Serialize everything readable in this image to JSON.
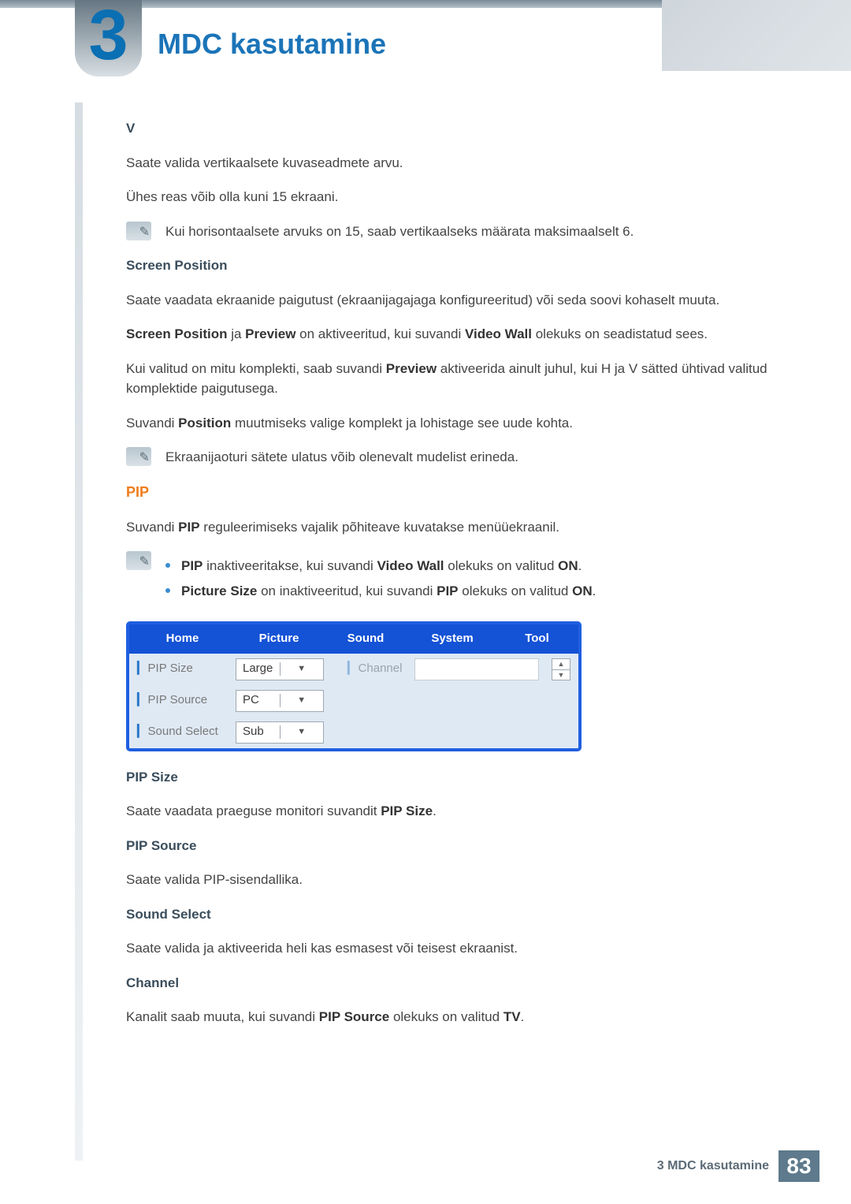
{
  "chapter": {
    "num": "3",
    "title": "MDC kasutamine"
  },
  "v": {
    "heading": "V",
    "p1": "Saate valida vertikaalsete kuvaseadmete arvu.",
    "p2": "Ühes reas võib olla kuni 15 ekraani.",
    "note": "Kui horisontaalsete arvuks on 15, saab vertikaalseks määrata maksimaalselt 6."
  },
  "sp": {
    "heading": "Screen Position",
    "p1": "Saate vaadata ekraanide paigutust (ekraanijagajaga konfigureeritud) või seda soovi kohaselt muuta.",
    "p2": "Screen Position ja Preview on aktiveeritud, kui suvandi Video Wall olekuks on seadistatud sees.",
    "p3": "Kui valitud on mitu komplekti, saab suvandi Preview aktiveerida ainult juhul, kui H ja V sätted ühtivad valitud komplektide paigutusega.",
    "p4": "Suvandi Position muutmiseks valige komplekt ja lohistage see uude kohta.",
    "note": "Ekraanijaoturi sätete ulatus võib olenevalt mudelist erineda."
  },
  "pip": {
    "heading": "PIP",
    "intro": "Suvandi PIP reguleerimiseks vajalik põhiteave kuvatakse menüüekraanil.",
    "b1": "PIP inaktiveeritakse, kui suvandi Video Wall olekuks on valitud ON.",
    "b2": "Picture Size on inaktiveeritud, kui suvandi PIP olekuks on valitud ON."
  },
  "fig": {
    "tabs": [
      "Home",
      "Picture",
      "Sound",
      "System",
      "Tool"
    ],
    "r1": {
      "label": "PIP Size",
      "val": "Large"
    },
    "r2": {
      "label": "PIP Source",
      "val": "PC"
    },
    "r3": {
      "label": "Sound Select",
      "val": "Sub"
    },
    "ch": "Channel"
  },
  "def": {
    "h1": "PIP Size",
    "p1": "Saate vaadata praeguse monitori suvandit PIP Size.",
    "h2": "PIP Source",
    "p2": "Saate valida PIP-sisendallika.",
    "h3": "Sound Select",
    "p3": "Saate valida ja aktiveerida heli kas esmasest või teisest ekraanist.",
    "h4": "Channel",
    "p4": "Kanalit saab muuta, kui suvandi PIP Source olekuks on valitud TV."
  },
  "footer": {
    "txt": "3 MDC kasutamine",
    "pg": "83"
  }
}
